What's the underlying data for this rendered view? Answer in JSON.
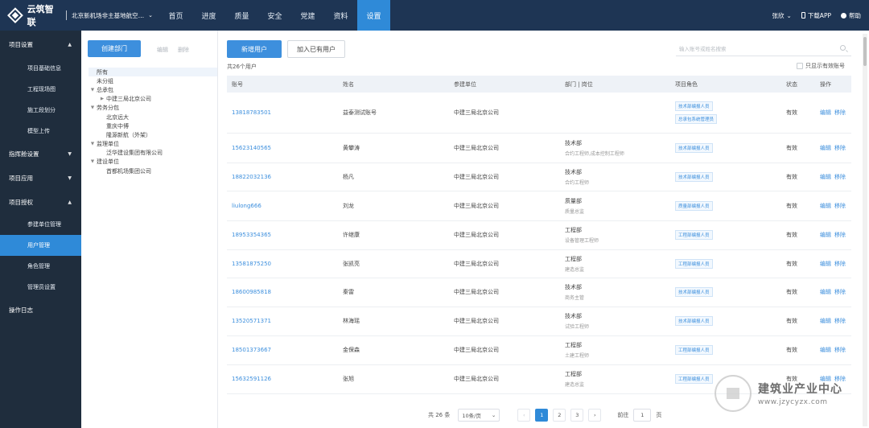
{
  "topbar": {
    "logo": "云筑智联",
    "project": "北京新机场非主基地航空公...",
    "nav": [
      "首页",
      "进度",
      "质量",
      "安全",
      "党建",
      "资料",
      "设置"
    ],
    "active_nav": 6,
    "user": "张欣",
    "download": "下载APP",
    "help": "帮助"
  },
  "sidebar": {
    "groups": [
      {
        "label": "项目设置",
        "arrow": "▲",
        "subs": [
          "项目基础信息",
          "工程现场图",
          "施工段划分",
          "模型上传"
        ]
      },
      {
        "label": "指挥舱设置",
        "arrow": "▼",
        "subs": []
      },
      {
        "label": "项目应用",
        "arrow": "▼",
        "subs": []
      },
      {
        "label": "项目授权",
        "arrow": "▲",
        "subs": [
          "参建单位管理",
          "用户管理",
          "角色管理",
          "管理员设置"
        ]
      },
      {
        "label": "操作日志",
        "arrow": "",
        "subs": []
      }
    ],
    "active_sub": "用户管理"
  },
  "tree_panel": {
    "create_button": "创建部门",
    "edit_link": "编辑",
    "delete_link": "删除",
    "nodes": [
      {
        "label": "所有",
        "level": 0,
        "caret": "",
        "selected": true
      },
      {
        "label": "未分组",
        "level": 0,
        "caret": ""
      },
      {
        "label": "总承包",
        "level": 0,
        "caret": "▼"
      },
      {
        "label": "中建三局北京公司",
        "level": 1,
        "caret": "▶"
      },
      {
        "label": "劳务分包",
        "level": 0,
        "caret": "▼"
      },
      {
        "label": "北京远大",
        "level": 1,
        "caret": ""
      },
      {
        "label": "重庆中博",
        "level": 1,
        "caret": ""
      },
      {
        "label": "隆源新航（外架）",
        "level": 1,
        "caret": ""
      },
      {
        "label": "监理单位",
        "level": 0,
        "caret": "▼"
      },
      {
        "label": "泛华建设集团有限公司",
        "level": 1,
        "caret": ""
      },
      {
        "label": "建设单位",
        "level": 0,
        "caret": "▼"
      },
      {
        "label": "首都机场集团公司",
        "level": 1,
        "caret": ""
      }
    ]
  },
  "main": {
    "add_user_button": "新增用户",
    "join_user_button": "加入已有用户",
    "search_placeholder": "输入账号或姓名搜索",
    "count_text": "共26个用户",
    "only_valid_label": "只显示有效账号",
    "columns": [
      "账号",
      "姓名",
      "参建单位",
      "部门 | 岗位",
      "项目角色",
      "状态",
      "操作"
    ],
    "rows": [
      {
        "account": "13818783501",
        "name": "益泰测试账号",
        "unit": "中建三局北京公司",
        "dept": "",
        "post": "",
        "roles": [
          "技术部编报人员",
          "总承包系统管理员"
        ],
        "status": "有效"
      },
      {
        "account": "15623140565",
        "name": "黄攀涛",
        "unit": "中建三局北京公司",
        "dept": "技术部",
        "post": "合约工程师,成本控制工程师",
        "roles": [
          "技术部编报人员"
        ],
        "status": "有效"
      },
      {
        "account": "18822032136",
        "name": "杨凡",
        "unit": "中建三局北京公司",
        "dept": "技术部",
        "post": "合约工程师",
        "roles": [
          "技术部编报人员"
        ],
        "status": "有效"
      },
      {
        "account": "liulong666",
        "name": "刘龙",
        "unit": "中建三局北京公司",
        "dept": "质量部",
        "post": "质量总监",
        "roles": [
          "质量部编报人员"
        ],
        "status": "有效"
      },
      {
        "account": "18953354365",
        "name": "许继康",
        "unit": "中建三局北京公司",
        "dept": "工程部",
        "post": "设备管理工程师",
        "roles": [
          "工程部编报人员"
        ],
        "status": "有效"
      },
      {
        "account": "13581875250",
        "name": "张凯亮",
        "unit": "中建三局北京公司",
        "dept": "工程部",
        "post": "建造总监",
        "roles": [
          "工程部编报人员"
        ],
        "status": "有效"
      },
      {
        "account": "18600985818",
        "name": "秦雷",
        "unit": "中建三局北京公司",
        "dept": "技术部",
        "post": "商务主管",
        "roles": [
          "技术部编报人员"
        ],
        "status": "有效"
      },
      {
        "account": "13520571371",
        "name": "林海瑶",
        "unit": "中建三局北京公司",
        "dept": "技术部",
        "post": "试验工程师",
        "roles": [
          "技术部编报人员"
        ],
        "status": "有效"
      },
      {
        "account": "18501373667",
        "name": "金保森",
        "unit": "中建三局北京公司",
        "dept": "工程部",
        "post": "土建工程师",
        "roles": [
          "工程部编报人员"
        ],
        "status": "有效"
      },
      {
        "account": "15632591126",
        "name": "张旭",
        "unit": "中建三局北京公司",
        "dept": "工程部",
        "post": "建造总监",
        "roles": [
          "工程部编报人员"
        ],
        "status": "有效"
      }
    ],
    "op_edit": "编辑",
    "op_remove": "移除"
  },
  "pagination": {
    "total": "共 26 条",
    "page_size": "10条/页",
    "pages": [
      "1",
      "2",
      "3"
    ],
    "current": "1",
    "goto_label": "前往",
    "goto_value": "1",
    "page_suffix": "页"
  },
  "watermark": {
    "cn": "建筑业产业中心",
    "url": "www.jzycyzx.com"
  }
}
